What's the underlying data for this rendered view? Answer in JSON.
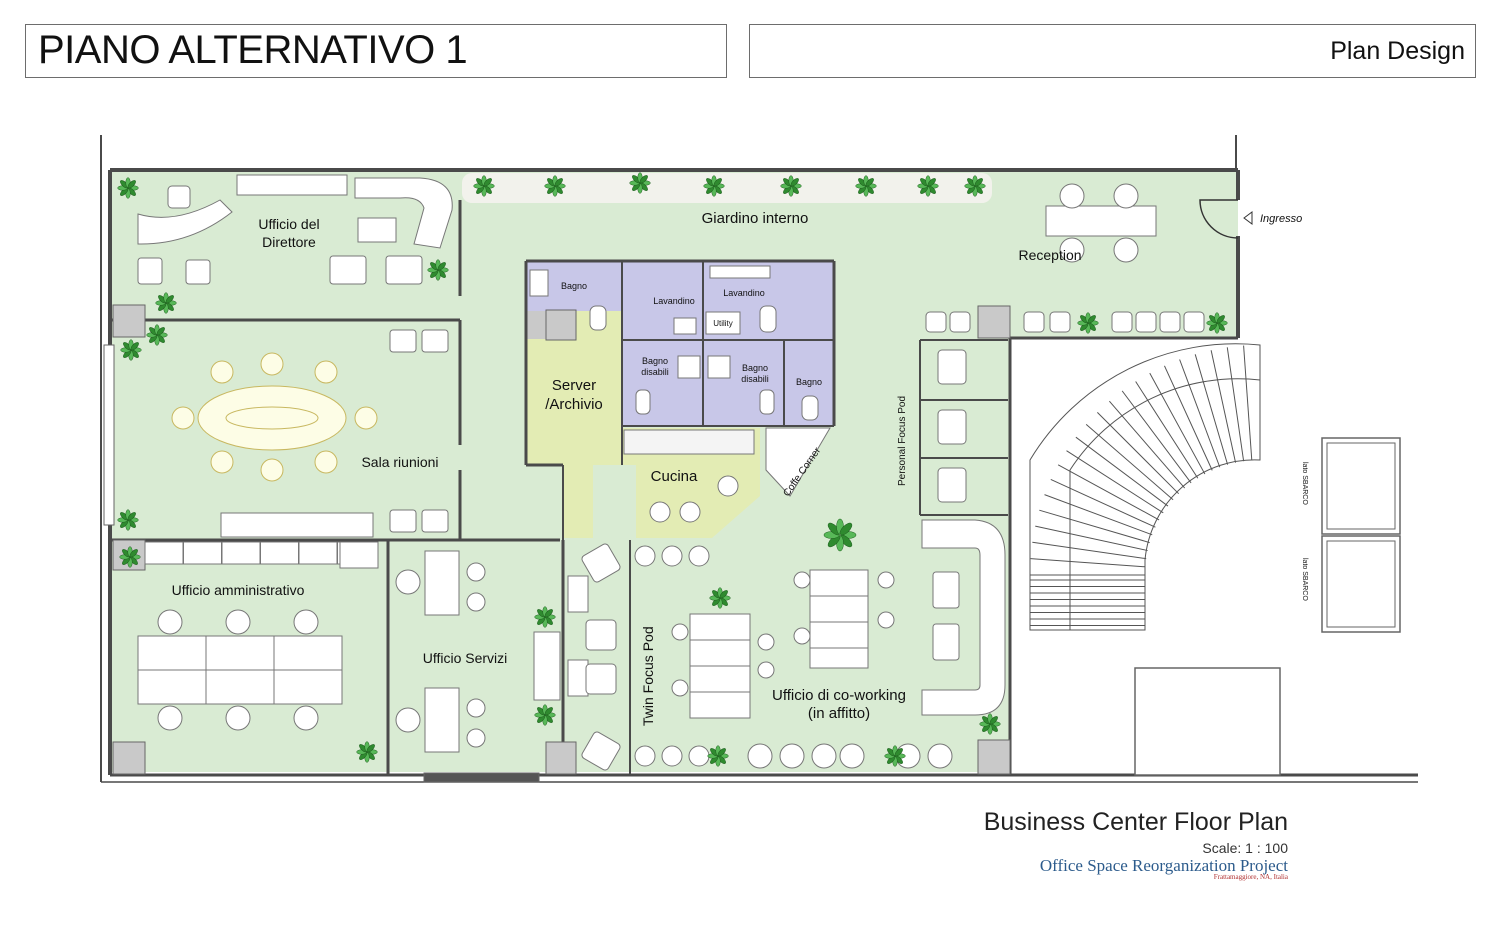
{
  "header": {
    "title": "PIANO ALTERNATIVO 1",
    "tag": "Plan Design"
  },
  "rooms": {
    "ufficio_direttore": [
      "Ufficio del",
      "Direttore"
    ],
    "giardino": "Giardino interno",
    "reception": "Reception",
    "ingresso": "Ingresso",
    "sala_riunioni": "Sala riunioni",
    "bagno_1": "Bagno",
    "lavandino_1": "Lavandino",
    "lavandino_2": "Lavandino",
    "utility": "Utility",
    "bagno_disabili_1": [
      "Bagno",
      "disabili"
    ],
    "bagno_disabili_2": [
      "Bagno",
      "disabili"
    ],
    "bagno_2": "Bagno",
    "server": [
      "Server",
      "/Archivio"
    ],
    "cucina": "Cucina",
    "coffe_corner": "Coffe Corner",
    "personal_focus_pod": "Personal Focus Pod",
    "ufficio_amministrativo": "Ufficio amministrativo",
    "ufficio_servizi": "Ufficio Servizi",
    "twin_focus_pod": "Twin Focus Pod",
    "coworking": [
      "Ufficio di co-working",
      "(in affitto)"
    ],
    "lato_sbarco_1": "lato SBARCO",
    "lato_sbarco_2": "lato SBARCO"
  },
  "footer": {
    "title": "Business Center Floor Plan",
    "scale": "Scale: 1 : 100",
    "project": "Office Space Reorganization Project",
    "place": "Frattamaggiore, NA, Italia"
  },
  "colors": {
    "floor": "#d9ebd3",
    "bathroom": "#c8c7e8",
    "kitchen": "#e3ecb4",
    "wall": "#4a4a4a",
    "project_text": "#2c5b8c"
  }
}
